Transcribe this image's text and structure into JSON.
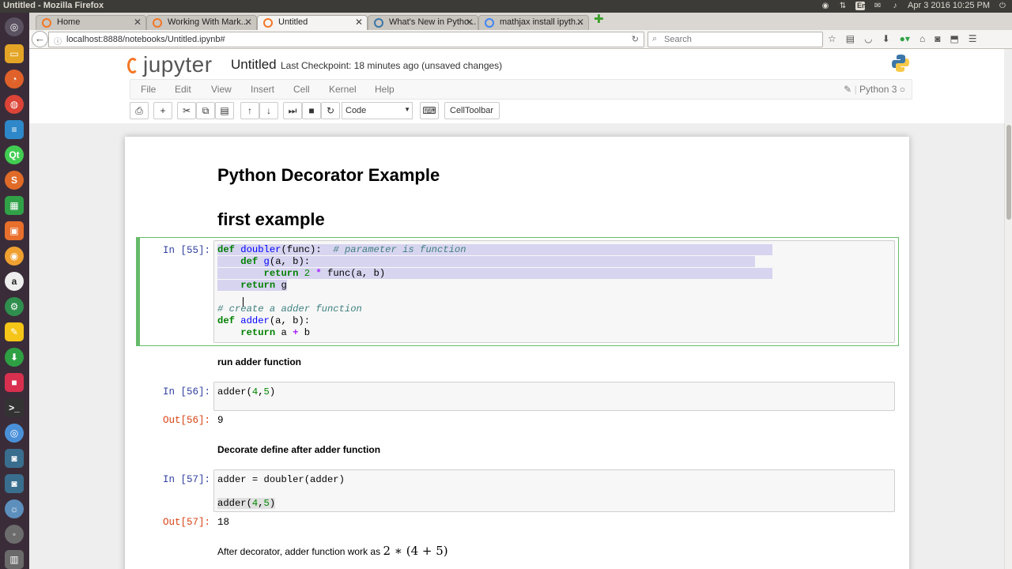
{
  "os": {
    "window_title": "Untitled - Mozilla Firefox",
    "keyboard_layout": "En",
    "clock": "Apr 3 2016 10:25 PM",
    "tray_icons": [
      "camera-icon",
      "network-icon",
      "keyboard-layout-indicator",
      "mail-icon",
      "volume-icon",
      "power-icon"
    ],
    "launcher_icons": [
      "ubuntu-dash-icon",
      "files-icon",
      "firefox-icon",
      "chrome-icon",
      "text-editor-icon",
      "qt-creator-icon",
      "sublime-icon",
      "spreadsheet-icon",
      "software-center-icon",
      "camera-app-icon",
      "amazon-icon",
      "system-settings-icon",
      "notes-icon",
      "download-icon",
      "app-icon",
      "terminal-icon",
      "image-viewer-icon",
      "app-icon-2",
      "app-icon-3",
      "app-icon-4",
      "app-icon-5",
      "trash-icon"
    ]
  },
  "browser": {
    "tabs": [
      {
        "label": "Home",
        "active": false
      },
      {
        "label": "Working With Mark...",
        "active": false
      },
      {
        "label": "Untitled",
        "active": true
      },
      {
        "label": "What's New in Pytho...",
        "active": false
      },
      {
        "label": "mathjax install ipyth...",
        "active": false
      }
    ],
    "url": "localhost:8888/notebooks/Untitled.ipynb#",
    "search_placeholder": "Search"
  },
  "jupyter": {
    "logo_text": "jupyter",
    "notebook_name": "Untitled",
    "checkpoint": "Last Checkpoint: 18 minutes ago (unsaved changes)",
    "menu": [
      "File",
      "Edit",
      "View",
      "Insert",
      "Cell",
      "Kernel",
      "Help"
    ],
    "kernel_name": "Python 3",
    "cell_type": "Code",
    "celltoolbar_label": "CellToolbar"
  },
  "notebook": {
    "h1": "Python Decorator Example",
    "h2": "first example",
    "cell1_prompt": "In [55]:",
    "cell1_code_lines": [
      "def doubler(func):  # parameter is function",
      "    def g(a, b):",
      "        return 2 * func(a, b)",
      "    return g",
      "",
      "# create a adder function",
      "def adder(a, b):",
      "    return a + b"
    ],
    "md_run_adder": "run adder function",
    "cell2_prompt": "In [56]:",
    "cell2_code": "adder(4,5)",
    "out2_prompt": "Out[56]:",
    "out2_value": "9",
    "md_decorate": "Decorate define after adder function",
    "cell3_prompt": "In [57]:",
    "cell3_line1": "adder = doubler(adder)",
    "cell3_line2": "adder(4,5)",
    "out3_prompt": "Out[57]:",
    "out3_value": "18",
    "md_after": "After decorator, adder function work as",
    "md_after_math": "2 ∗ (4 + 5)"
  }
}
